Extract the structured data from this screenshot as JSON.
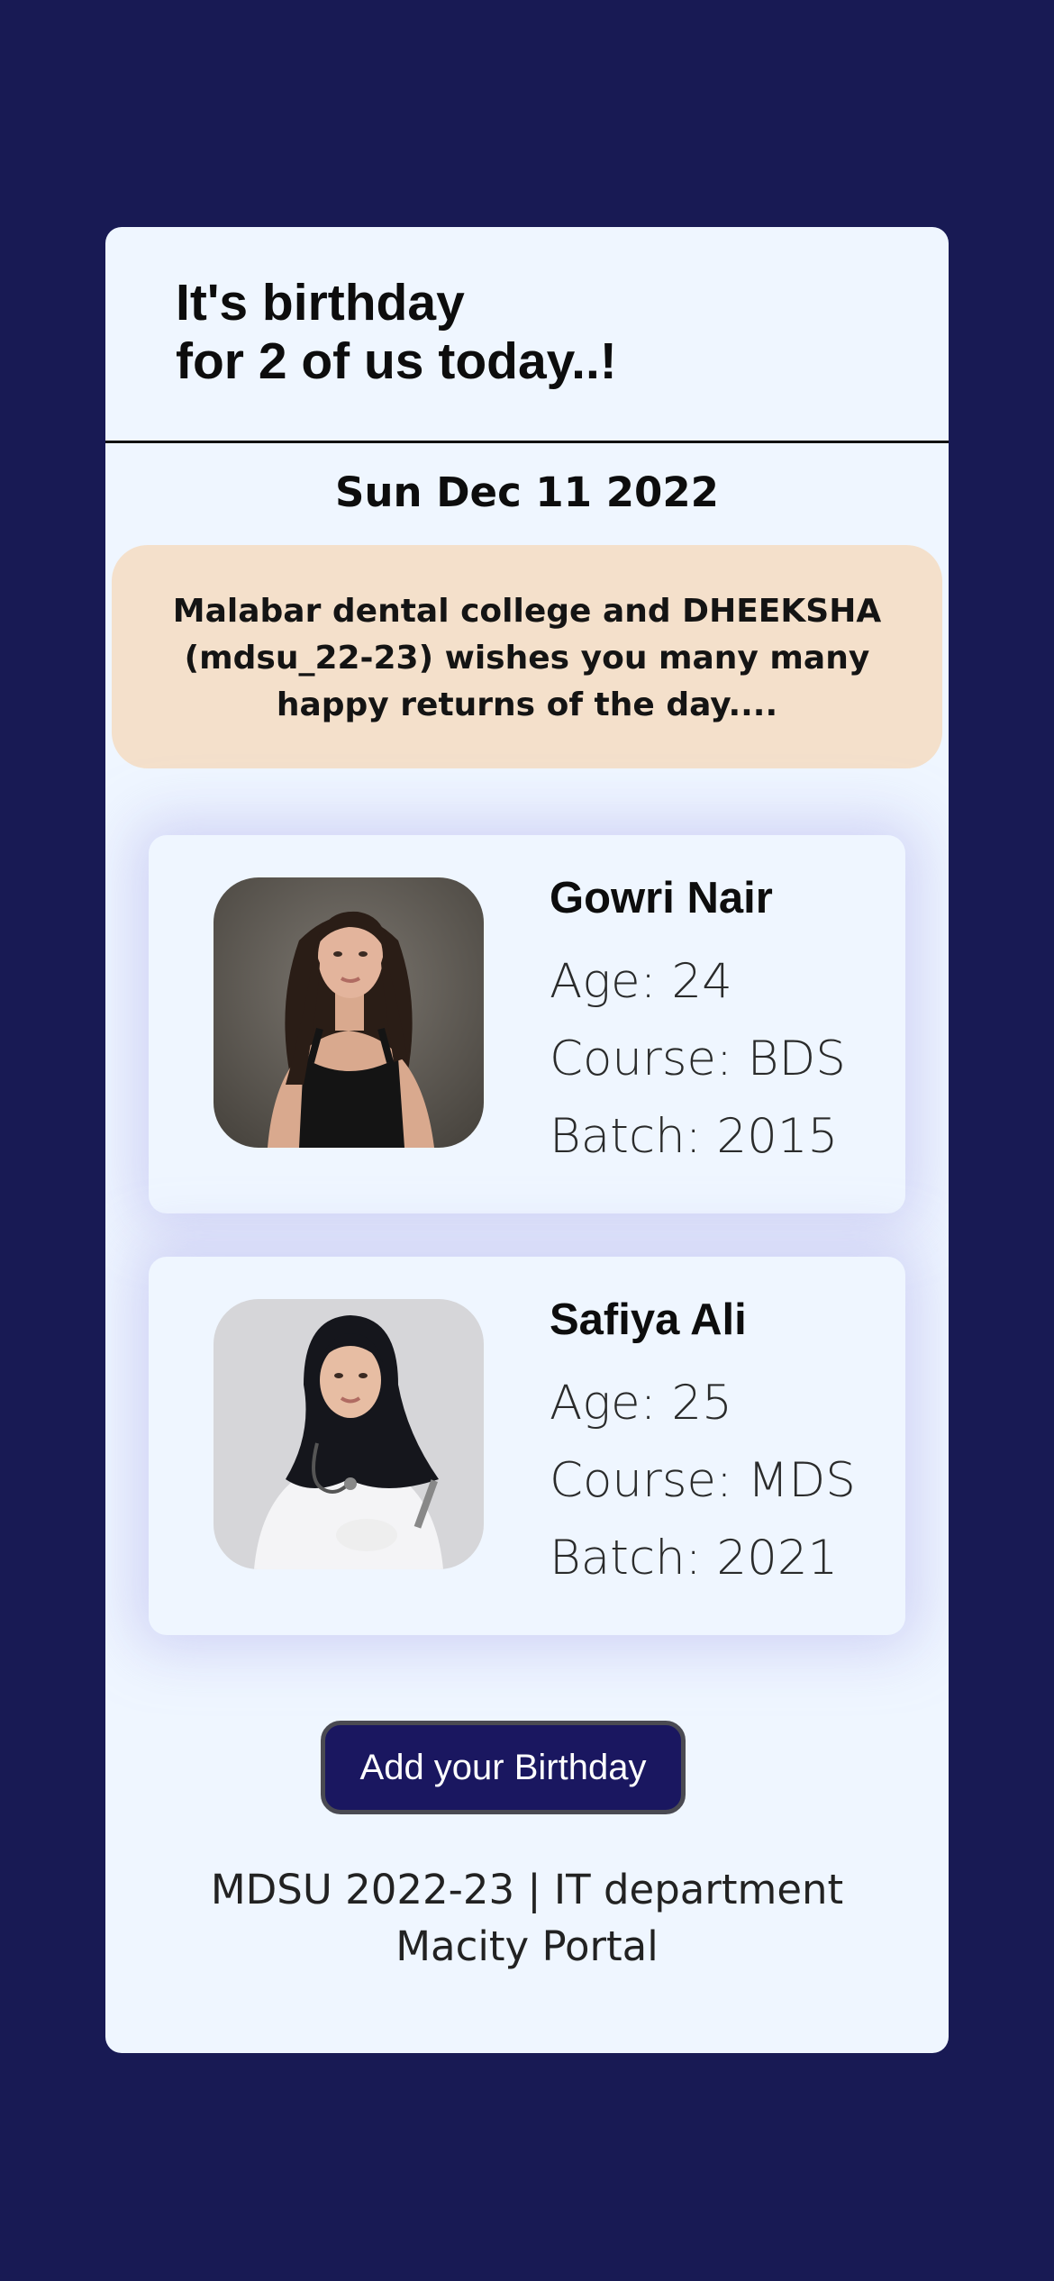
{
  "header": {
    "title_line1": "It's birthday",
    "title_line2": "for 2 of us today..!"
  },
  "date": "Sun Dec 11 2022",
  "banner": {
    "text": "Malabar dental college and DHEEKSHA (mdsu_22-23) wishes you many many happy returns of the day...."
  },
  "people": [
    {
      "name": "Gowri Nair",
      "age": "Age: 24",
      "course": "Course: BDS",
      "batch": "Batch: 2015"
    },
    {
      "name": "Safiya Ali",
      "age": "Age: 25",
      "course": "Course: MDS",
      "batch": "Batch: 2021"
    }
  ],
  "actions": {
    "add_birthday_label": "Add your Birthday"
  },
  "footer": {
    "line1": "MDSU 2022-23 | IT department",
    "line2": "Macity Portal"
  },
  "colors": {
    "page_background": "#181a54",
    "card_background": "#eff6ff",
    "banner_background": "#f4e0cb",
    "button_background": "#1a1760"
  }
}
